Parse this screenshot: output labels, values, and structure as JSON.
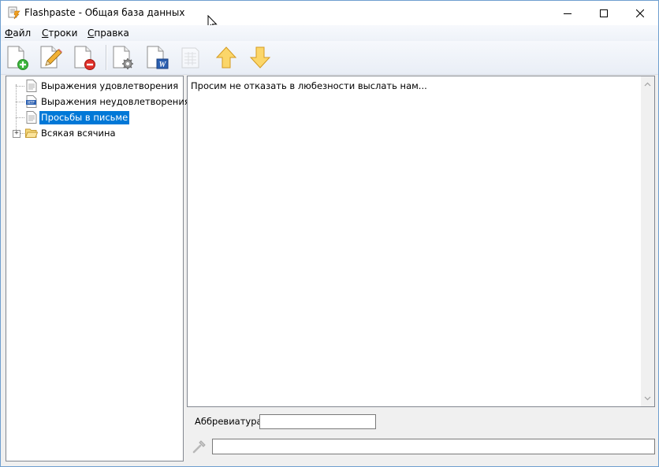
{
  "window": {
    "title": "Flashpaste - Общая база данных",
    "accent_color": "#0078d7"
  },
  "menu": {
    "items": [
      "Файл",
      "Строки",
      "Справка"
    ]
  },
  "toolbar": {
    "buttons": [
      {
        "name": "add-line",
        "icon": "document-plus-icon"
      },
      {
        "name": "edit-line",
        "icon": "document-pencil-icon"
      },
      {
        "name": "delete-line",
        "icon": "document-minus-icon"
      },
      {
        "name": "properties",
        "icon": "document-gear-icon"
      },
      {
        "name": "word",
        "icon": "document-word-icon"
      },
      {
        "name": "table",
        "icon": "document-table-icon",
        "disabled": true
      },
      {
        "name": "move-up",
        "icon": "arrow-up-icon"
      },
      {
        "name": "move-down",
        "icon": "arrow-down-icon"
      }
    ]
  },
  "tree": {
    "items": [
      {
        "label": "Выражения удовлетворения",
        "icon": "text-document-icon",
        "selected": false
      },
      {
        "label": "Выражения неудовлетворения",
        "icon": "rtf-document-icon",
        "selected": false
      },
      {
        "label": "Просьбы в письме",
        "icon": "text-document-icon",
        "selected": true
      },
      {
        "label": "Всякая всячина",
        "icon": "folder-icon",
        "selected": false,
        "expander": "+"
      }
    ]
  },
  "editor": {
    "text": "Просим не отказать в любезности выслать нам..."
  },
  "abbreviation": {
    "label": "Аббревиатура:",
    "value": ""
  },
  "hotkey": {
    "value": ""
  }
}
